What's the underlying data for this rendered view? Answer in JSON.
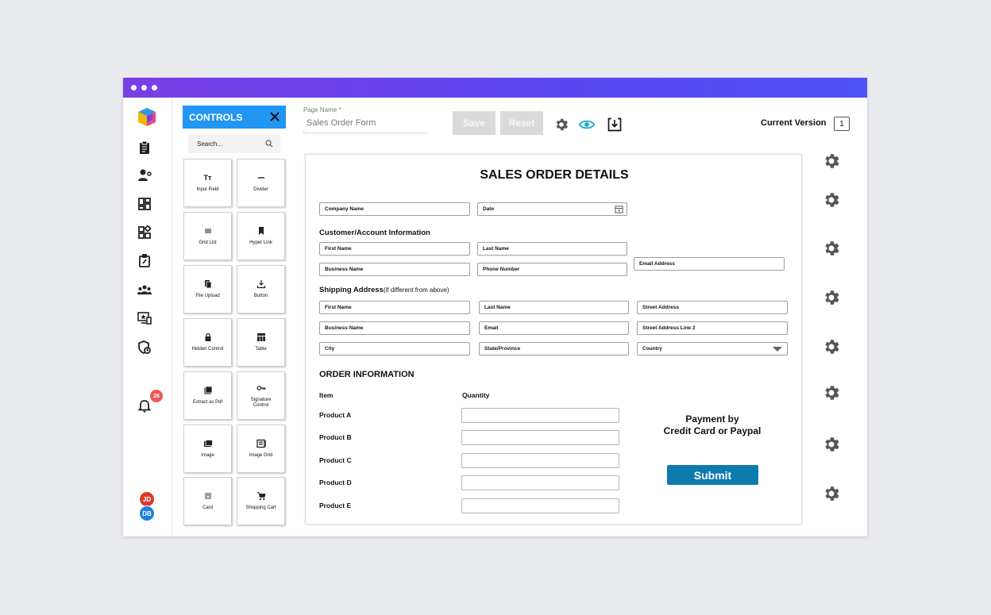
{
  "controls": {
    "title": "CONTROLS",
    "search_placeholder": "Search...",
    "tiles": [
      {
        "label": "Input Field",
        "icon": "text-format-icon"
      },
      {
        "label": "Divider",
        "icon": "divider-icon"
      },
      {
        "label": "Grid List",
        "icon": "list-icon"
      },
      {
        "label": "Hyper Link",
        "icon": "bookmark-icon"
      },
      {
        "label": "File Upload",
        "icon": "files-icon"
      },
      {
        "label": "Button",
        "icon": "download-icon"
      },
      {
        "label": "Hidden Control",
        "icon": "lock-icon"
      },
      {
        "label": "Table",
        "icon": "table-icon"
      },
      {
        "label": "Extract as Pdf",
        "icon": "pdf-icon"
      },
      {
        "label": "Signature Control",
        "icon": "key-icon"
      },
      {
        "label": "Image",
        "icon": "image-icon"
      },
      {
        "label": "Image Grid",
        "icon": "image-grid-icon"
      },
      {
        "label": "Card",
        "icon": "card-icon"
      },
      {
        "label": "Shopping Cart",
        "icon": "cart-icon"
      }
    ]
  },
  "toolbar": {
    "page_name_label": "Page Name *",
    "page_name_value": "Sales Order Form",
    "save_label": "Save",
    "reset_label": "Reset",
    "version_label": "Current Version",
    "version_value": "1"
  },
  "nav": {
    "notification_count": "26",
    "avatars": [
      {
        "initials": "JD",
        "color": "#d83b2b"
      },
      {
        "initials": "DB",
        "color": "#1e7fe0"
      }
    ]
  },
  "form": {
    "title": "SALES ORDER DETAILS",
    "company_name": "Company Name",
    "date": "Date",
    "customer_section": "Customer/Account Information",
    "first_name": "First Name",
    "last_name": "Last Name",
    "business_name": "Business Name",
    "phone_number": "Phone Number",
    "email_address": "Email Address",
    "shipping_section": "Shipping Address",
    "shipping_section_note": "(if different from above)",
    "ship_first_name": "First Name",
    "ship_last_name": "Last Name",
    "street_address": "Street Address",
    "ship_business_name": "Business Name",
    "email": "Email",
    "street_address_2": "Street Address Line 2",
    "city": "City",
    "state": "State/Province",
    "country": "Country",
    "order_section": "ORDER INFORMATION",
    "item_header": "Item",
    "quantity_header": "Quantity",
    "products": [
      "Product A",
      "Product B",
      "Product C",
      "Product D",
      "Product E"
    ],
    "payment_line1": "Payment by",
    "payment_line2": "Credit Card or Paypal",
    "submit_label": "Submit"
  },
  "colors": {
    "titlebar": "#5a46f0",
    "controls_header": "#2196f3",
    "accent_eye": "#19a7d4",
    "submit": "#0e7bb0",
    "badge": "#e85a5a"
  }
}
